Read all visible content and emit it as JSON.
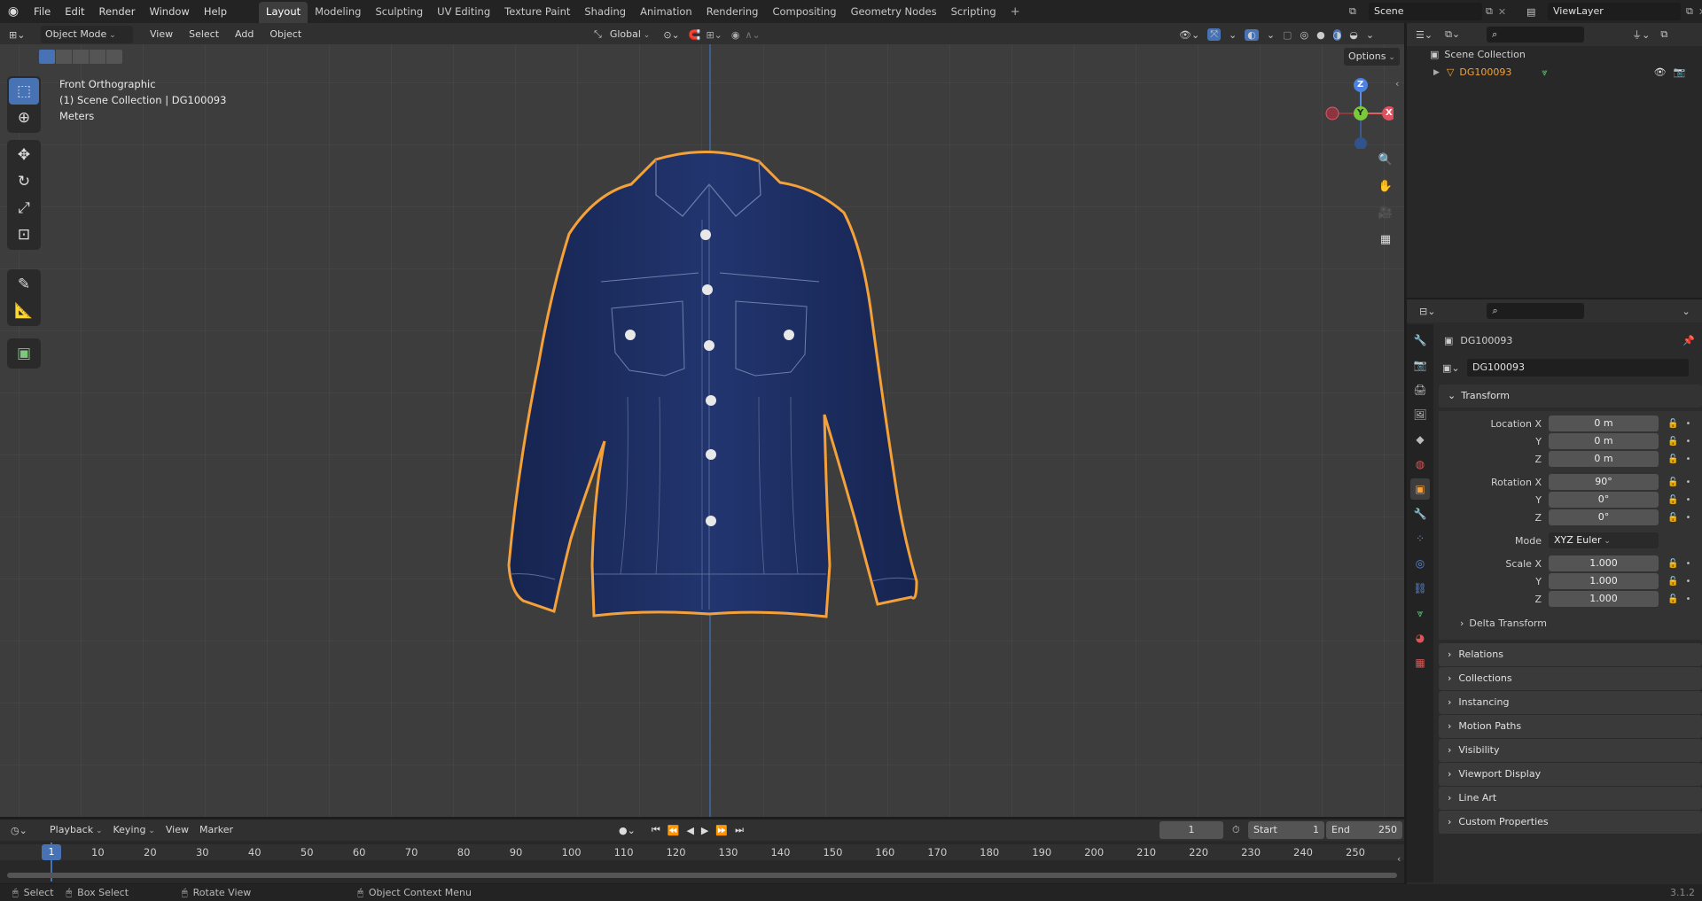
{
  "menus": [
    "File",
    "Edit",
    "Render",
    "Window",
    "Help"
  ],
  "workspaces": [
    "Layout",
    "Modeling",
    "Sculpting",
    "UV Editing",
    "Texture Paint",
    "Shading",
    "Animation",
    "Rendering",
    "Compositing",
    "Geometry Nodes",
    "Scripting"
  ],
  "active_workspace": "Layout",
  "add_tab": "+",
  "scene": "Scene",
  "view_layer": "ViewLayer",
  "viewport_header": {
    "mode": "Object Mode",
    "menus": [
      "View",
      "Select",
      "Add",
      "Object"
    ],
    "orientation": "Global",
    "options": "Options"
  },
  "overlay_text": {
    "view": "Front Orthographic",
    "collection": "(1) Scene Collection | DG100093",
    "units": "Meters"
  },
  "gizmo": {
    "z": "Z",
    "y": "Y",
    "x": "X"
  },
  "outliner": {
    "root": "Scene Collection",
    "object": "DG100093"
  },
  "properties": {
    "object_name": "DG100093",
    "data_name": "DG100093",
    "transform_label": "Transform",
    "location": {
      "label_x": "Location X",
      "x": "0 m",
      "label_y": "Y",
      "y": "0 m",
      "label_z": "Z",
      "z": "0 m"
    },
    "rotation": {
      "label_x": "Rotation X",
      "x": "90°",
      "label_y": "Y",
      "y": "0°",
      "label_z": "Z",
      "z": "0°"
    },
    "mode": {
      "label": "Mode",
      "value": "XYZ Euler"
    },
    "scale": {
      "label_x": "Scale X",
      "x": "1.000",
      "label_y": "Y",
      "y": "1.000",
      "label_z": "Z",
      "z": "1.000"
    },
    "delta": "Delta Transform",
    "panels": [
      "Relations",
      "Collections",
      "Instancing",
      "Motion Paths",
      "Visibility",
      "Viewport Display",
      "Line Art",
      "Custom Properties"
    ]
  },
  "timeline": {
    "menus": [
      "Playback",
      "Keying",
      "View",
      "Marker"
    ],
    "current_frame": "1",
    "start_label": "Start",
    "start": "1",
    "end_label": "End",
    "end": "250",
    "ticks": [
      "1",
      "10",
      "20",
      "30",
      "40",
      "50",
      "60",
      "70",
      "80",
      "90",
      "100",
      "110",
      "120",
      "130",
      "140",
      "150",
      "160",
      "170",
      "180",
      "190",
      "200",
      "210",
      "220",
      "230",
      "240",
      "250"
    ]
  },
  "statusbar": {
    "select": "Select",
    "box_select": "Box Select",
    "rotate": "Rotate View",
    "context": "Object Context Menu",
    "version": "3.1.2"
  },
  "colors": {
    "accent": "#4772b3",
    "selection": "#f5a13a",
    "jacket": "#1c2c5e"
  }
}
